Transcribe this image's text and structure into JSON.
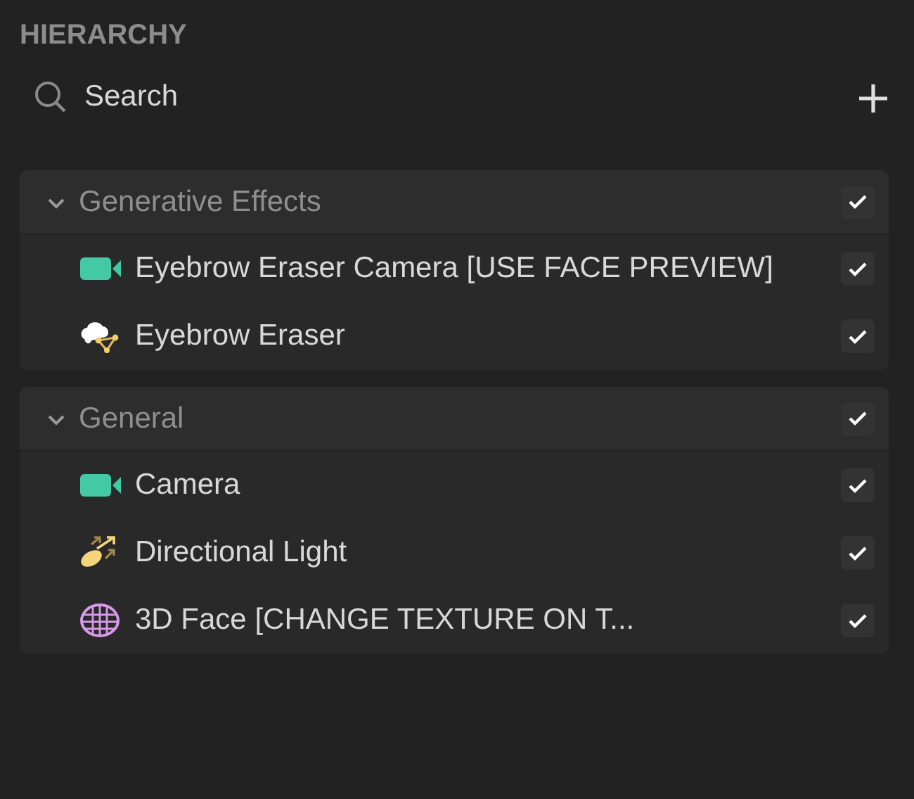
{
  "panel": {
    "title": "HIERARCHY"
  },
  "search": {
    "placeholder": "Search"
  },
  "groups": [
    {
      "label": "Generative Effects",
      "expanded": true,
      "checked": true,
      "children": [
        {
          "label": "Eyebrow Eraser Camera [USE FACE PREVIEW]",
          "kind": "camera",
          "checked": true
        },
        {
          "label": "Eyebrow Eraser",
          "kind": "effect",
          "checked": true
        }
      ]
    },
    {
      "label": "General",
      "expanded": true,
      "checked": true,
      "children": [
        {
          "label": "Camera",
          "kind": "camera",
          "checked": true
        },
        {
          "label": "Directional Light",
          "kind": "light",
          "checked": true
        },
        {
          "label": "3D Face [CHANGE TEXTURE ON T...",
          "kind": "mesh",
          "checked": true
        }
      ]
    }
  ]
}
